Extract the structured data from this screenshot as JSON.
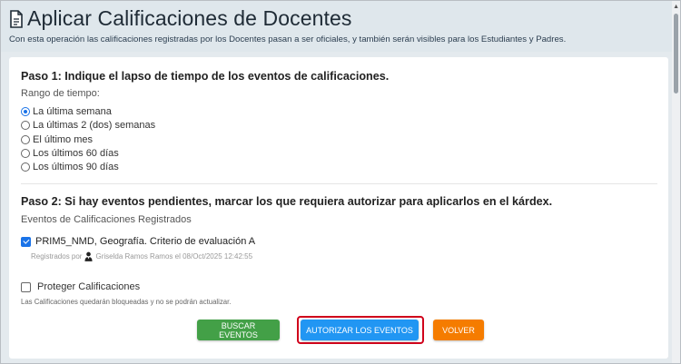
{
  "header": {
    "title": "Aplicar Calificaciones de Docentes",
    "subtitle": "Con esta operación las calificaciones registradas por los Docentes pasan a ser oficiales, y también serán visibles para los Estudiantes y Padres.",
    "icon": "document-icon"
  },
  "step1": {
    "heading": "Paso 1: Indique el lapso de tiempo de los eventos de calificaciones.",
    "range_label": "Rango de tiempo:",
    "options": [
      {
        "label": "La última semana",
        "checked": true
      },
      {
        "label": "La últimas 2 (dos) semanas",
        "checked": false
      },
      {
        "label": "El último mes",
        "checked": false
      },
      {
        "label": "Los últimos 60 días",
        "checked": false
      },
      {
        "label": "Los últimos 90 días",
        "checked": false
      }
    ]
  },
  "step2": {
    "heading": "Paso 2: Si hay eventos pendientes, marcar los que requiera autorizar para aplicarlos en el kárdex.",
    "events_label": "Eventos de Calificaciones Registrados",
    "events": [
      {
        "text": "PRIM5_NMD, Geografía.  Criterio de evaluación A",
        "checked": true,
        "registered_prefix": "Registrados por",
        "registered_info": "Griselda Ramos Ramos el 08/Oct/2025 12:42:55"
      }
    ]
  },
  "protect": {
    "label": "Proteger Calificaciones",
    "checked": false,
    "note": "Las Calificaciones quedarán bloqueadas y no se podrán actualizar."
  },
  "buttons": {
    "search": "BUSCAR EVENTOS",
    "authorize": "AUTORIZAR LOS EVENTOS",
    "back": "VOLVER"
  },
  "colors": {
    "search": "#43a047",
    "authorize": "#2196f3",
    "back": "#f57c00",
    "highlight": "#d0021b",
    "accent": "#1a73e8"
  }
}
